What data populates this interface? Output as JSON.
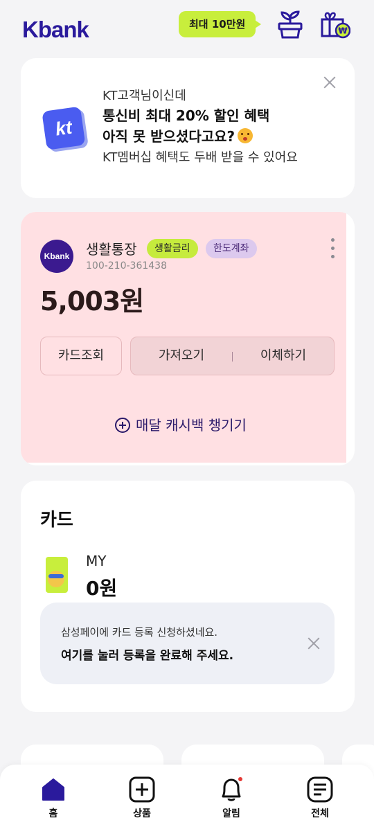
{
  "header": {
    "logo": "Kbank",
    "promo": "최대 10만원",
    "icons": [
      "plant-pot-icon",
      "gift-box-icon"
    ]
  },
  "kt_banner": {
    "line1": "KT고객님이신데",
    "line2": "통신비 최대 20% 할인 혜택",
    "line3": "아직 못 받으셨다고요?",
    "line4": "KT멤버십 혜택도 두배 받을 수 있어요",
    "logo_text": "kt",
    "emoji": "disappointed-face-icon"
  },
  "account": {
    "avatar_text": "Kbank",
    "name": "생활통장",
    "tag1": "생활금리",
    "tag2": "한도계좌",
    "number": "100-210-361438",
    "balance": "5,003원",
    "btn_card": "카드조회",
    "btn_bring": "가져오기",
    "btn_transfer": "이체하기",
    "cashback": "매달 캐시백 챙기기"
  },
  "cards": {
    "title": "카드",
    "card_name": "MY",
    "card_amount": "0원",
    "notice_line1": "삼성페이에 카드 등록 신청하셨네요.",
    "notice_line2": "여기를 눌러 등록을 완료해 주세요."
  },
  "bottom_nav": {
    "home": "홈",
    "products": "상품",
    "alerts": "알림",
    "all": "전체"
  },
  "colors": {
    "brand": "#2a1a9c",
    "accent": "#c8ee3c",
    "highlight": "#ffe0e3"
  }
}
